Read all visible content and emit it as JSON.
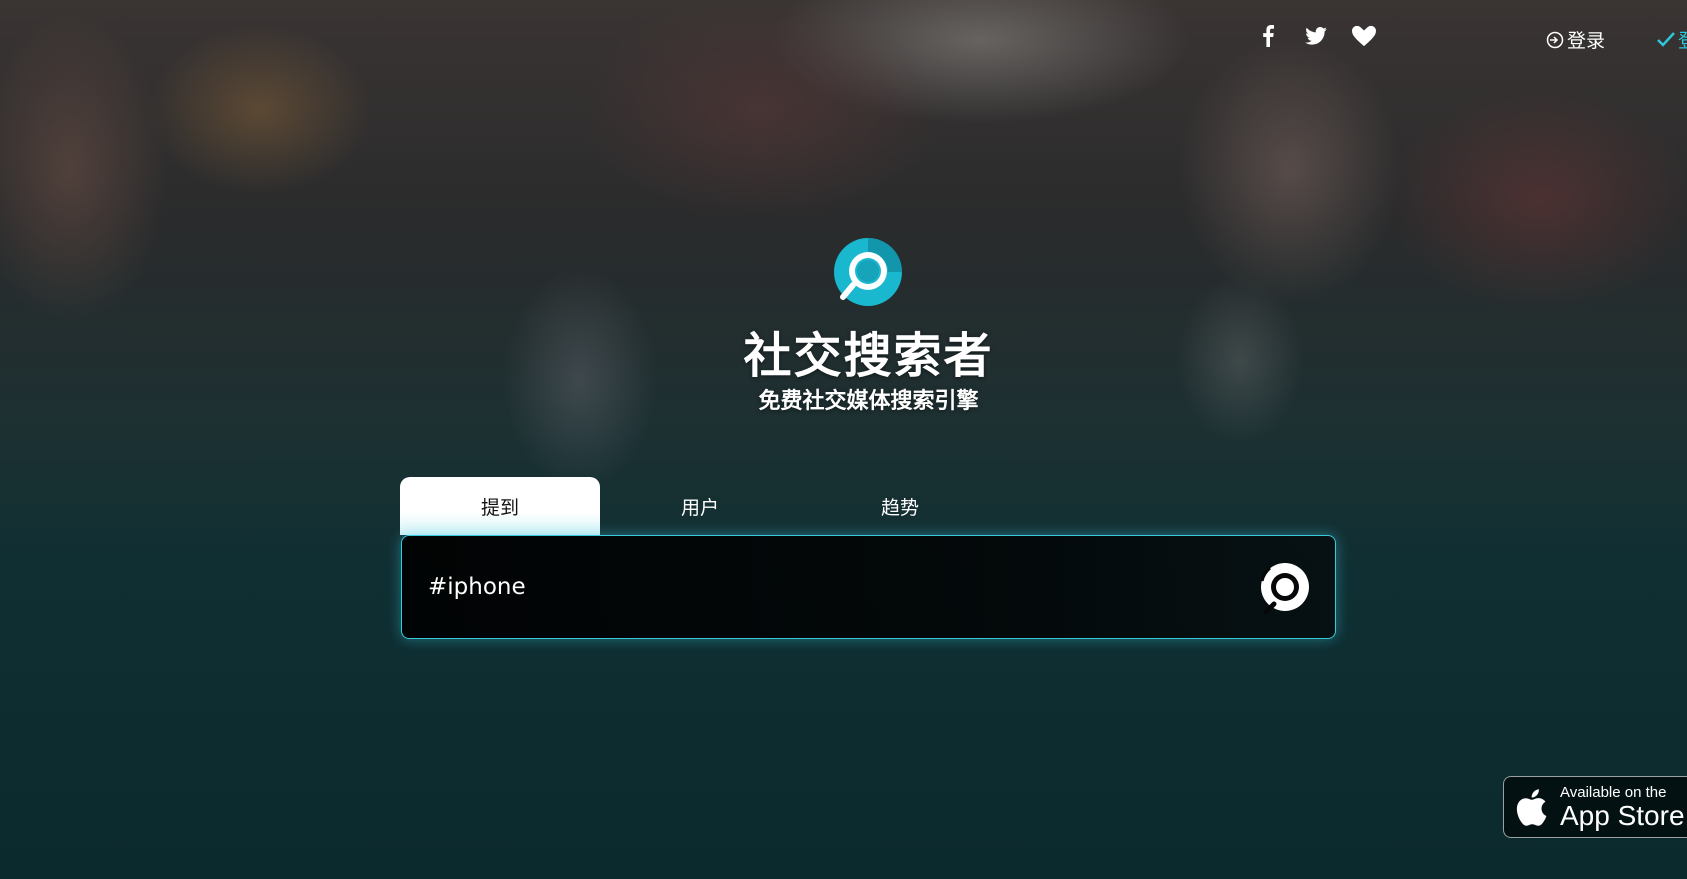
{
  "header": {
    "social_icons": [
      "facebook-icon",
      "twitter-icon",
      "heart-icon"
    ],
    "login_label": "登录",
    "signup_label": "登"
  },
  "hero": {
    "title": "社交搜索者",
    "subtitle": "免费社交媒体搜索引擎"
  },
  "tabs": [
    {
      "label": "提到",
      "active": true
    },
    {
      "label": "用户",
      "active": false
    },
    {
      "label": "趋势",
      "active": false
    }
  ],
  "search": {
    "value": "#iphone",
    "placeholder": ""
  },
  "appstore": {
    "line1": "Available on the",
    "line2": "App Store"
  },
  "colors": {
    "accent": "#39c9dd",
    "logo_outer": "#1ab8cf",
    "logo_inner": "#0d7f93"
  }
}
